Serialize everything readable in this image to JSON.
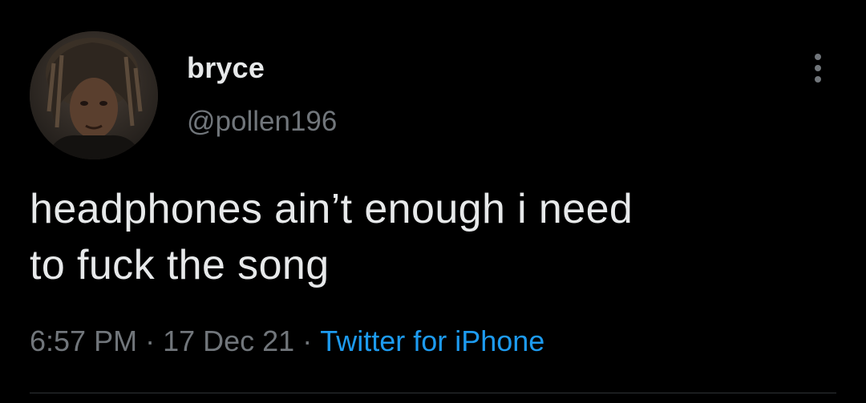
{
  "author": {
    "display_name": "bryce",
    "handle": "@pollen196"
  },
  "tweet": {
    "text_line1": "headphones ain’t enough i need",
    "text_line2": "to fuck the song"
  },
  "meta": {
    "time": "6:57 PM",
    "separator": "·",
    "date": "17 Dec 21",
    "source": "Twitter for iPhone"
  },
  "icons": {
    "more": "more-vertical-icon"
  },
  "colors": {
    "background": "#000000",
    "primary_text": "#e7e9ea",
    "secondary_text": "#71767b",
    "accent": "#1d9bf0"
  }
}
